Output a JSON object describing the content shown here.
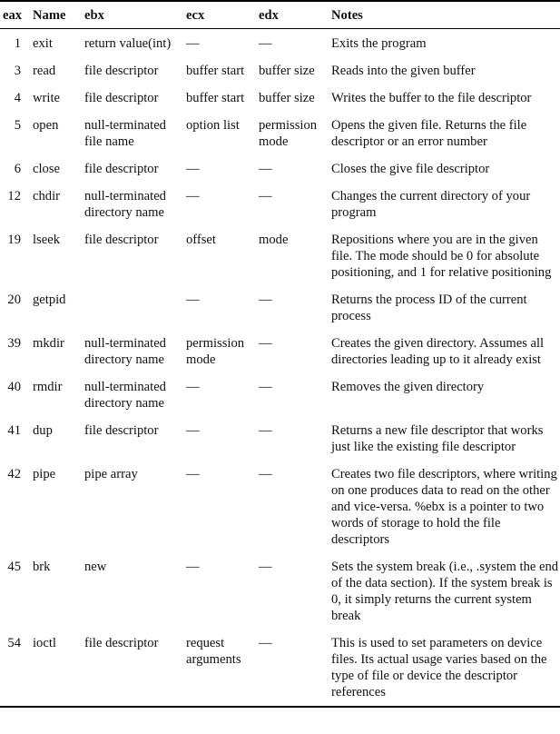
{
  "table": {
    "headers": {
      "eax": "eax",
      "name": "Name",
      "ebx": "ebx",
      "ecx": "ecx",
      "edx": "edx",
      "notes": "Notes"
    },
    "rows": [
      {
        "eax": "1",
        "name": "exit",
        "ebx": "return value(int)",
        "ecx": "—",
        "edx": "—",
        "notes": "Exits the program"
      },
      {
        "eax": "3",
        "name": "read",
        "ebx": "file descriptor",
        "ecx": "buffer start",
        "edx": "buffer size",
        "notes": "Reads into the given buffer"
      },
      {
        "eax": "4",
        "name": "write",
        "ebx": "file descriptor",
        "ecx": "buffer start",
        "edx": "buffer size",
        "notes": "Writes the buffer to the file descriptor"
      },
      {
        "eax": "5",
        "name": "open",
        "ebx": "null-terminated file name",
        "ecx": "option list",
        "edx": "permission mode",
        "notes": "Opens the given file. Returns the file descriptor or an error number"
      },
      {
        "eax": "6",
        "name": "close",
        "ebx": "file descriptor",
        "ecx": "—",
        "edx": "—",
        "notes": "Closes the give file descriptor"
      },
      {
        "eax": "12",
        "name": "chdir",
        "ebx": "null-terminated directory name",
        "ecx": "—",
        "edx": "—",
        "notes": "Changes the current directory of your program"
      },
      {
        "eax": "19",
        "name": "lseek",
        "ebx": "file descriptor",
        "ecx": "offset",
        "edx": "mode",
        "notes": "Repositions where you are in the given file. The mode should be 0 for absolute positioning, and 1 for relative positioning"
      },
      {
        "eax": "20",
        "name": "getpid",
        "ebx": "",
        "ecx": "—",
        "edx": "—",
        "notes": "Returns the process ID of the current process"
      },
      {
        "eax": "39",
        "name": "mkdir",
        "ebx": "null-terminated directory name",
        "ecx": "permission mode",
        "edx": "—",
        "notes": "Creates the given directory. Assumes all directories leading up to it already exist"
      },
      {
        "eax": "40",
        "name": "rmdir",
        "ebx": "null-terminated directory name",
        "ecx": "—",
        "edx": "—",
        "notes": "Removes the given directory"
      },
      {
        "eax": "41",
        "name": "dup",
        "ebx": "file descriptor",
        "ecx": "—",
        "edx": "—",
        "notes": "Returns a new file descriptor that works just like the existing file descriptor"
      },
      {
        "eax": "42",
        "name": "pipe",
        "ebx": "pipe array",
        "ecx": "—",
        "edx": "—",
        "notes": "Creates two file descriptors, where writing on one produces data to read on the other and vice-versa. %ebx is a pointer to two words of storage to hold the file descriptors"
      },
      {
        "eax": "45",
        "name": "brk",
        "ebx": "new",
        "ecx": "—",
        "edx": "—",
        "notes": "Sets the system break (i.e., .system the end of the data section). If the system break is 0, it simply returns the current system break"
      },
      {
        "eax": "54",
        "name": "ioctl",
        "ebx": "file descriptor",
        "ecx": "request arguments",
        "edx": "—",
        "notes": "This is used to set parameters on device files. Its actual usage varies based on the type of file or device the descriptor references"
      }
    ]
  }
}
